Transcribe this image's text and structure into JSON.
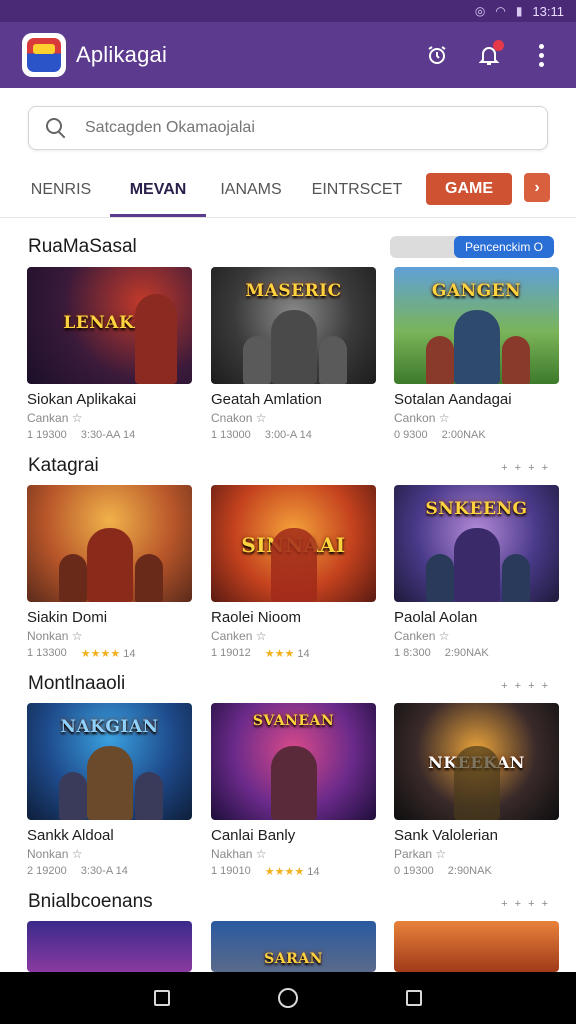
{
  "status_bar": {
    "time": "13:11"
  },
  "app": {
    "title": "Aplikagai"
  },
  "search": {
    "placeholder": "Satcagden Okamaojalai"
  },
  "tabs": [
    {
      "label": "NENRIS",
      "active": false
    },
    {
      "label": "MEVAN",
      "active": true
    },
    {
      "label": "IANAMS",
      "active": false
    },
    {
      "label": "EINTRSCET",
      "active": false
    }
  ],
  "game_button": "GAME",
  "sections": [
    {
      "title": "RuaMaSasal",
      "toggle_label": "Pencenckim O",
      "cards": [
        {
          "thumb_label": "LENAKAI",
          "title": "Siokan Aplikakai",
          "dev": "Cankan ☆",
          "meta1": "1 19300",
          "meta2": "3:30-AA 14",
          "stars": ""
        },
        {
          "thumb_label": "MASERIC",
          "title": "Geatah Amlation",
          "dev": "Cnakon ☆",
          "meta1": "1 13000",
          "meta2": "3:00-A 14",
          "stars": ""
        },
        {
          "thumb_label": "GANGEN",
          "title": "Sotalan Aandagai",
          "dev": "Cankon ☆",
          "meta1": "0 9300",
          "meta2": "2:00NAK",
          "stars": ""
        }
      ]
    },
    {
      "title": "Katagrai",
      "more": "+ + + +",
      "cards": [
        {
          "thumb_label": "",
          "title": "Siakin Domi",
          "dev": "Nonkan ☆",
          "meta1": "1 13300",
          "meta2": "14",
          "stars": "★★★★"
        },
        {
          "thumb_label": "SINNAAI",
          "title": "Raolei Nioom",
          "dev": "Canken ☆",
          "meta1": "1 19012",
          "meta2": "14",
          "stars": "★★★"
        },
        {
          "thumb_label": "SNKEENG",
          "title": "Paolal Aolan",
          "dev": "Canken ☆",
          "meta1": "1 8:300",
          "meta2": "2:90NAK",
          "stars": ""
        }
      ]
    },
    {
      "title": "Montlnaaoli",
      "more": "+ + + +",
      "cards": [
        {
          "thumb_label": "NAKGIAN",
          "title": "Sankk Aldoal",
          "dev": "Nonkan ☆",
          "meta1": "2 19200",
          "meta2": "3:30-A 14",
          "stars": ""
        },
        {
          "thumb_label": "SVANEAN",
          "title": "Canlai Banly",
          "dev": "Nakhan ☆",
          "meta1": "1 19010",
          "meta2": "14",
          "stars": "★★★★"
        },
        {
          "thumb_label": "NKEEKAN",
          "title": "Sank Valolerian",
          "dev": "Parkan ☆",
          "meta1": "0 19300",
          "meta2": "2:90NAK",
          "stars": ""
        }
      ]
    },
    {
      "title": "Bnialbcoenans",
      "more": "+ + + +",
      "cards": [
        {
          "thumb_label": ""
        },
        {
          "thumb_label": "SARAN"
        },
        {
          "thumb_label": ""
        }
      ]
    }
  ],
  "colors": {
    "appbar": "#5c3a8e",
    "accent": "#cf5233",
    "toggle": "#2a6fd6"
  }
}
